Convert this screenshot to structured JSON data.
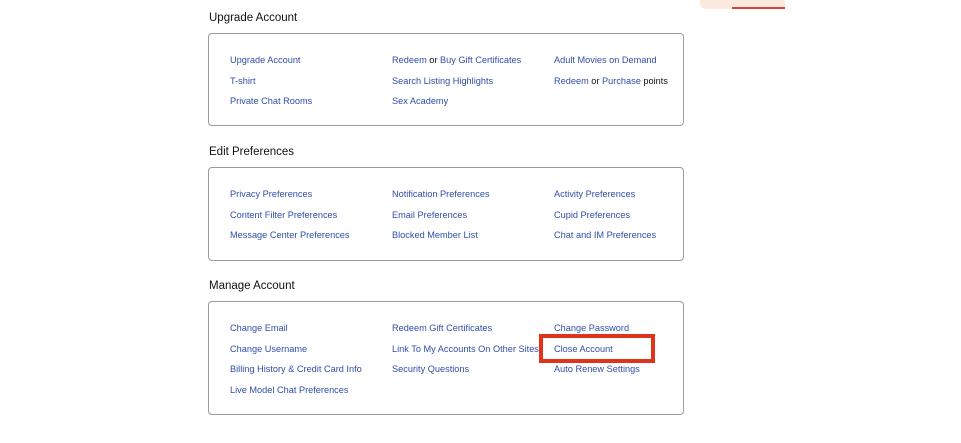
{
  "sections": [
    {
      "title": "Upgrade Account",
      "columns": [
        [
          {
            "parts": [
              {
                "text": "Upgrade Account",
                "link": true
              }
            ]
          },
          {
            "parts": [
              {
                "text": "T-shirt",
                "link": true
              }
            ]
          },
          {
            "parts": [
              {
                "text": "Private Chat Rooms",
                "link": true
              }
            ]
          }
        ],
        [
          {
            "parts": [
              {
                "text": "Redeem",
                "link": true
              },
              {
                "text": " or ",
                "link": false
              },
              {
                "text": "Buy Gift Certificates",
                "link": true
              }
            ]
          },
          {
            "parts": [
              {
                "text": "Search Listing Highlights",
                "link": true
              }
            ]
          },
          {
            "parts": [
              {
                "text": "Sex Academy",
                "link": true
              }
            ]
          }
        ],
        [
          {
            "parts": [
              {
                "text": "Adult Movies on Demand",
                "link": true
              }
            ]
          },
          {
            "parts": [
              {
                "text": "Redeem",
                "link": true
              },
              {
                "text": " or ",
                "link": false
              },
              {
                "text": "Purchase",
                "link": true
              },
              {
                "text": " points",
                "link": false
              }
            ]
          }
        ]
      ]
    },
    {
      "title": "Edit Preferences",
      "columns": [
        [
          {
            "parts": [
              {
                "text": "Privacy Preferences",
                "link": true
              }
            ]
          },
          {
            "parts": [
              {
                "text": "Content Filter Preferences",
                "link": true
              }
            ]
          },
          {
            "parts": [
              {
                "text": "Message Center Preferences",
                "link": true
              }
            ]
          }
        ],
        [
          {
            "parts": [
              {
                "text": "Notification Preferences",
                "link": true
              }
            ]
          },
          {
            "parts": [
              {
                "text": "Email Preferences",
                "link": true
              }
            ]
          },
          {
            "parts": [
              {
                "text": "Blocked Member List",
                "link": true
              }
            ]
          }
        ],
        [
          {
            "parts": [
              {
                "text": "Activity Preferences",
                "link": true
              }
            ]
          },
          {
            "parts": [
              {
                "text": "Cupid Preferences",
                "link": true
              }
            ]
          },
          {
            "parts": [
              {
                "text": "Chat and IM Preferences",
                "link": true
              }
            ]
          }
        ]
      ]
    },
    {
      "title": "Manage Account",
      "columns": [
        [
          {
            "parts": [
              {
                "text": "Change Email",
                "link": true
              }
            ]
          },
          {
            "parts": [
              {
                "text": "Change Username",
                "link": true
              }
            ]
          },
          {
            "parts": [
              {
                "text": "Billing History & Credit Card Info",
                "link": true
              }
            ]
          },
          {
            "parts": [
              {
                "text": "Live Model Chat Preferences",
                "link": true
              }
            ]
          }
        ],
        [
          {
            "parts": [
              {
                "text": "Redeem Gift Certificates",
                "link": true
              }
            ]
          },
          {
            "parts": [
              {
                "text": "Link To My Accounts On Other Sites",
                "link": true
              }
            ]
          },
          {
            "parts": [
              {
                "text": "Security Questions",
                "link": true
              }
            ]
          }
        ],
        [
          {
            "parts": [
              {
                "text": "Change Password",
                "link": true
              }
            ]
          },
          {
            "parts": [
              {
                "text": "Close Account",
                "link": true
              }
            ]
          },
          {
            "parts": [
              {
                "text": "Auto Renew Settings",
                "link": true
              }
            ]
          }
        ]
      ]
    }
  ],
  "colors": {
    "link": "#2f4ea8",
    "text": "#111111",
    "panel_border": "#9b9b9b",
    "highlight": "#e0331c"
  }
}
